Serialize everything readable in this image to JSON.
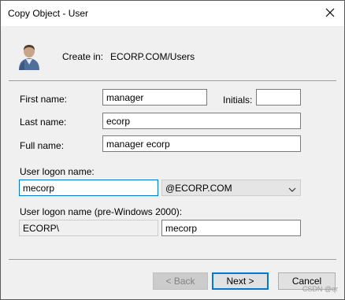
{
  "window": {
    "title": "Copy Object - User"
  },
  "header": {
    "create_in_label": "Create in:",
    "create_in_value": "ECORP.COM/Users"
  },
  "form": {
    "first_name_label": "First name:",
    "first_name_value": "manager",
    "initials_label": "Initials:",
    "initials_value": "",
    "last_name_label": "Last name:",
    "last_name_value": "ecorp",
    "full_name_label": "Full name:",
    "full_name_value": "manager ecorp",
    "logon_label": "User logon name:",
    "logon_value": "mecorp",
    "domain_value": "@ECORP.COM",
    "prewin_label": "User logon name (pre-Windows 2000):",
    "prewin_domain_value": "ECORP\\",
    "prewin_user_value": "mecorp"
  },
  "buttons": {
    "back": "< Back",
    "next": "Next >",
    "cancel": "Cancel"
  },
  "watermark": "CSDN @qr",
  "icons": {
    "header": "user-icon",
    "close": "close-icon",
    "dropdown": "chevron-down-icon"
  }
}
